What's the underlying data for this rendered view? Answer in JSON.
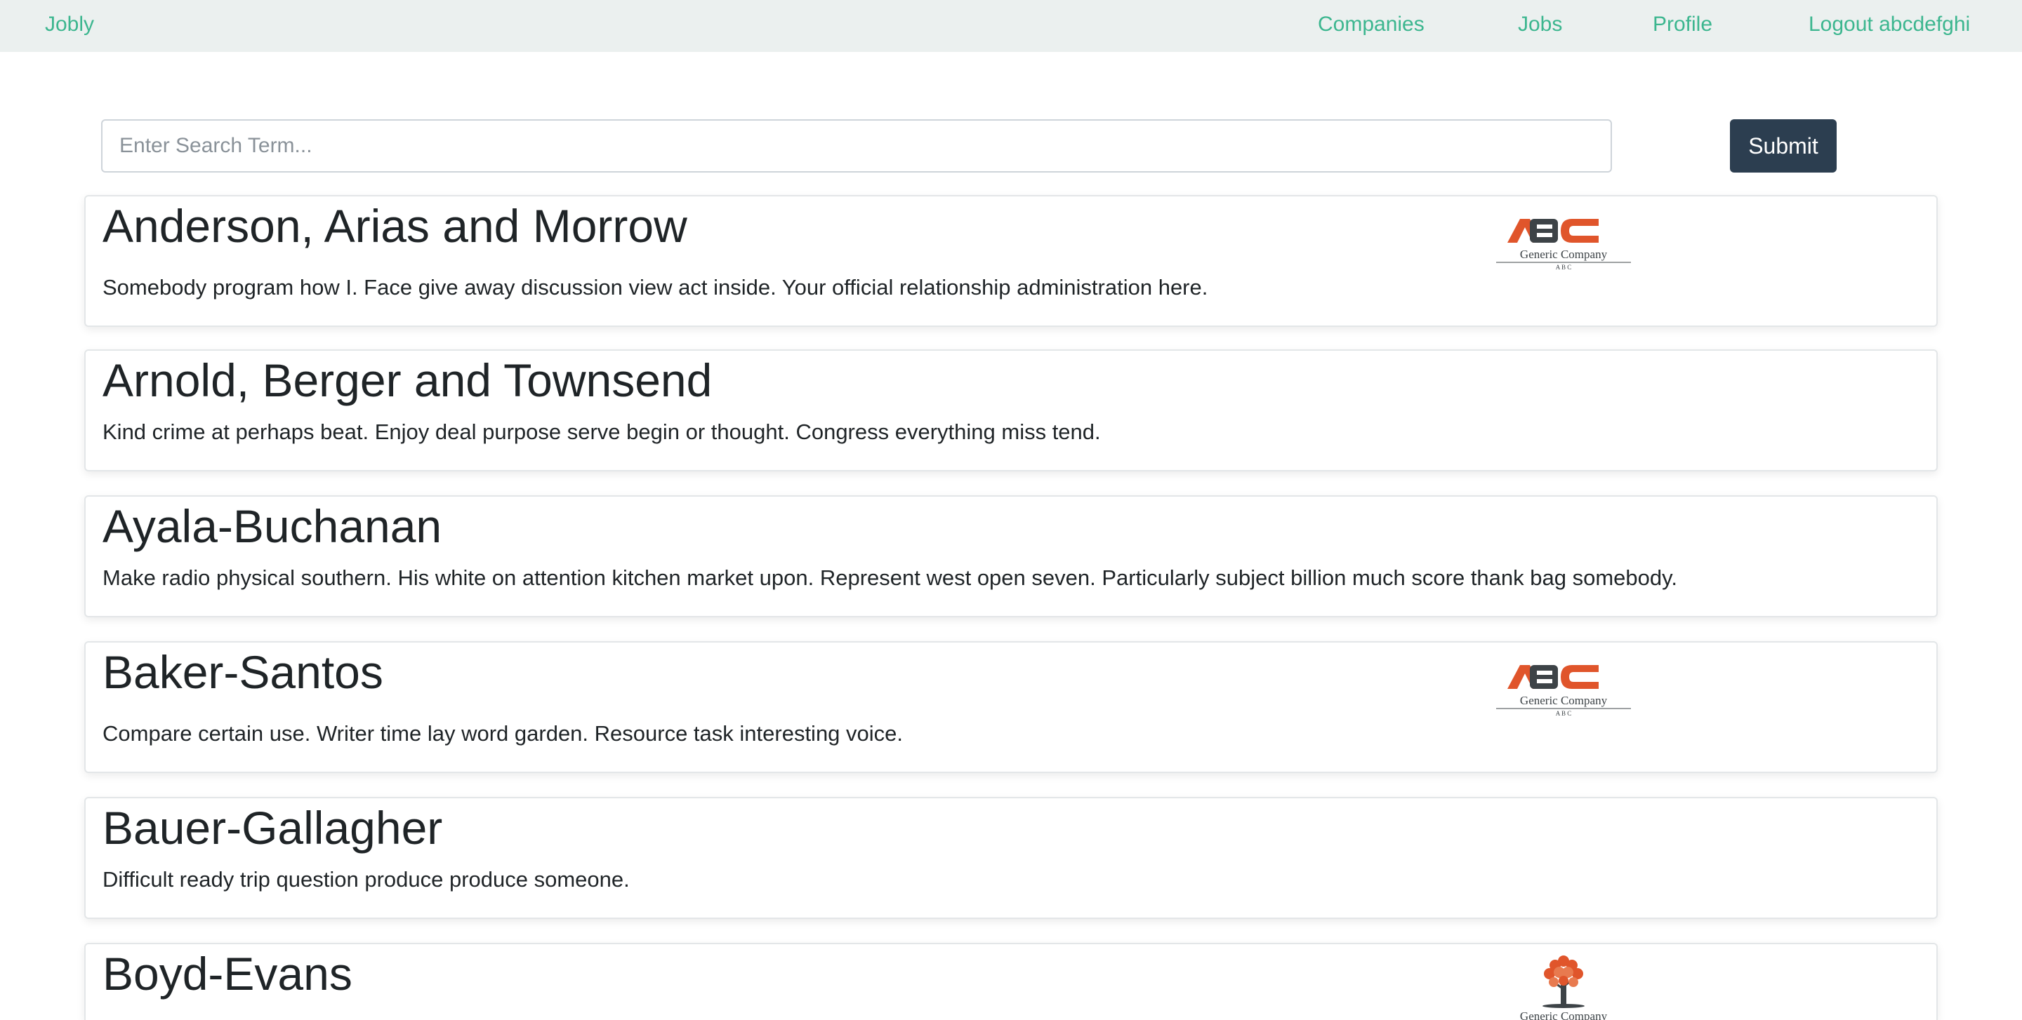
{
  "nav": {
    "brand": "Jobly",
    "companies": "Companies",
    "jobs": "Jobs",
    "profile": "Profile",
    "logout": "Logout abcdefghi"
  },
  "search": {
    "placeholder": "Enter Search Term...",
    "value": "",
    "submit_label": "Submit"
  },
  "companies": [
    {
      "name": "Anderson, Arias and Morrow",
      "description": "Somebody program how I. Face give away discussion view act inside. Your official relationship administration here.",
      "logo": "abc-generic-company-logo"
    },
    {
      "name": "Arnold, Berger and Townsend",
      "description": "Kind crime at perhaps beat. Enjoy deal purpose serve begin or thought. Congress everything miss tend.",
      "logo": ""
    },
    {
      "name": "Ayala-Buchanan",
      "description": "Make radio physical southern. His white on attention kitchen market upon. Represent west open seven. Particularly subject billion much score thank bag somebody.",
      "logo": ""
    },
    {
      "name": "Baker-Santos",
      "description": "Compare certain use. Writer time lay word garden. Resource task interesting voice.",
      "logo": "abc-generic-company-logo"
    },
    {
      "name": "Bauer-Gallagher",
      "description": "Difficult ready trip question produce produce someone.",
      "logo": ""
    },
    {
      "name": "Boyd-Evans",
      "description": "",
      "logo": "tree-generic-company-logo"
    }
  ],
  "logos": {
    "generic_company_text": "Generic Company",
    "abc_small": "A B C"
  },
  "colors": {
    "nav_bg": "#ebf0ef",
    "link": "#3cb68f",
    "submit_bg": "#2c3e50",
    "logo_orange": "#e0552b",
    "logo_dark": "#3d4347"
  }
}
